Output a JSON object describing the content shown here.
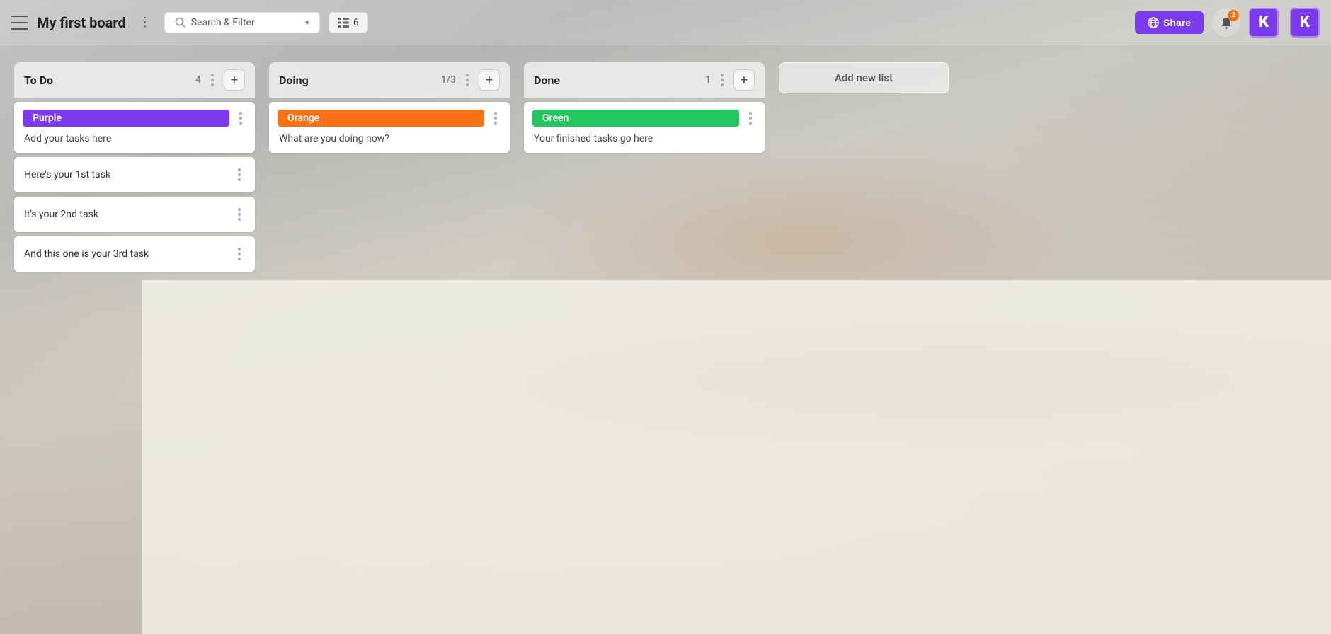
{
  "header": {
    "menu_label": "menu",
    "board_title": "My first board",
    "more_icon": "⋮",
    "search_placeholder": "Search & Filter",
    "search_chevron": "▾",
    "item_count": "6",
    "share_label": "Share",
    "notification_count": "2",
    "avatar_letter": "K"
  },
  "lists": [
    {
      "id": "todo",
      "title": "To Do",
      "count": "4",
      "cards": [
        {
          "id": "card-purple",
          "label": "Purple",
          "label_color": "purple",
          "text": "Add your tasks here",
          "has_label": true
        },
        {
          "id": "card-task1",
          "text": "Here's your 1st task",
          "has_label": false
        },
        {
          "id": "card-task2",
          "text": "It's your 2nd task",
          "has_label": false
        },
        {
          "id": "card-task3",
          "text": "And this one is your 3rd task",
          "has_label": false
        }
      ]
    },
    {
      "id": "doing",
      "title": "Doing",
      "count": "1/3",
      "cards": [
        {
          "id": "card-orange",
          "label": "Orange",
          "label_color": "orange",
          "text": "What are you doing now?",
          "has_label": true
        }
      ]
    },
    {
      "id": "done",
      "title": "Done",
      "count": "1",
      "cards": [
        {
          "id": "card-green",
          "label": "Green",
          "label_color": "green",
          "text": "Your finished tasks go here",
          "has_label": true
        }
      ]
    }
  ],
  "add_new_list": {
    "label": "Add new list"
  }
}
